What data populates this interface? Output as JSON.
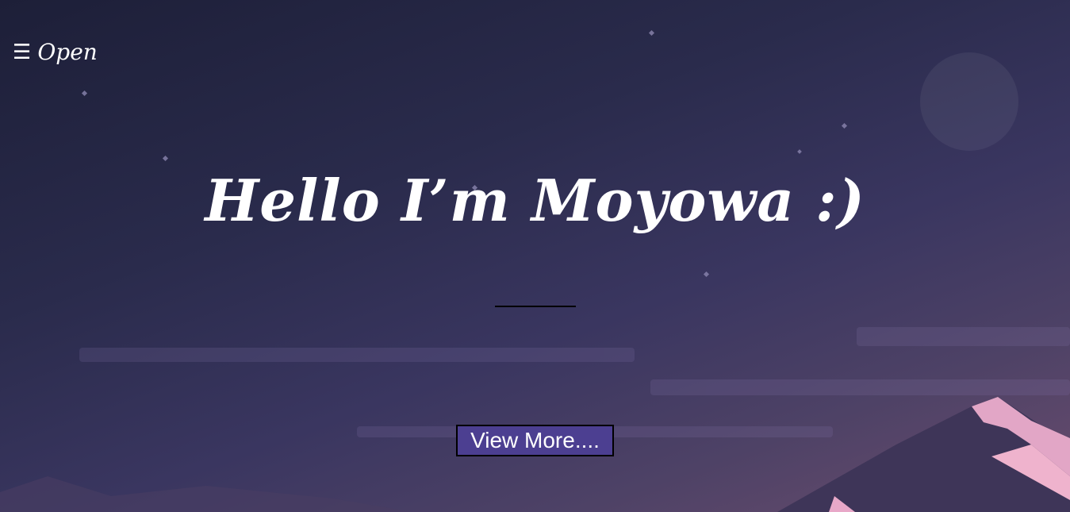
{
  "nav": {
    "menu_icon": "☰",
    "menu_label": "Open"
  },
  "hero": {
    "title": "Hello I’m Moyowa :)",
    "button_label": "View More...."
  },
  "colors": {
    "background_top": "#1d1f38",
    "background_bottom": "#6a4c6e",
    "button_fill": "#4c3f91",
    "divider": "#000000",
    "mountain_light": "#e8a8c8"
  },
  "icons": [
    "hamburger-icon",
    "moon-icon"
  ]
}
